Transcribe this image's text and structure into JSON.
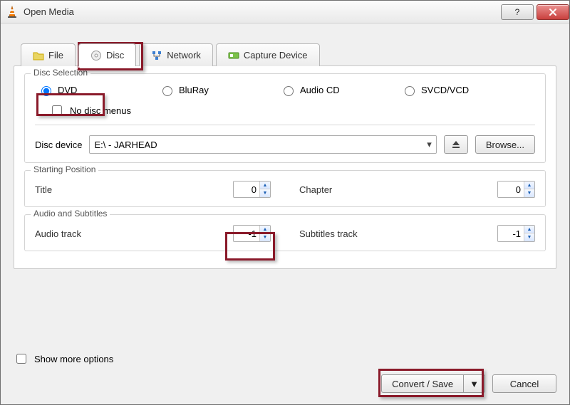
{
  "window": {
    "title": "Open Media"
  },
  "tabs": {
    "file": "File",
    "disc": "Disc",
    "network": "Network",
    "capture": "Capture Device"
  },
  "disc": {
    "legend": "Disc Selection",
    "dvd": "DVD",
    "bluray": "BluRay",
    "audiocd": "Audio CD",
    "svcd": "SVCD/VCD",
    "no_menus": "No disc menus",
    "device_label": "Disc device",
    "device_value": "E:\\ - JARHEAD",
    "browse": "Browse..."
  },
  "start": {
    "legend": "Starting Position",
    "title_label": "Title",
    "title_value": "0",
    "chapter_label": "Chapter",
    "chapter_value": "0"
  },
  "audio": {
    "legend": "Audio and Subtitles",
    "audio_label": "Audio track",
    "audio_value": "-1",
    "subs_label": "Subtitles track",
    "subs_value": "-1"
  },
  "footer": {
    "show_more": "Show more options",
    "convert": "Convert / Save",
    "cancel": "Cancel"
  }
}
